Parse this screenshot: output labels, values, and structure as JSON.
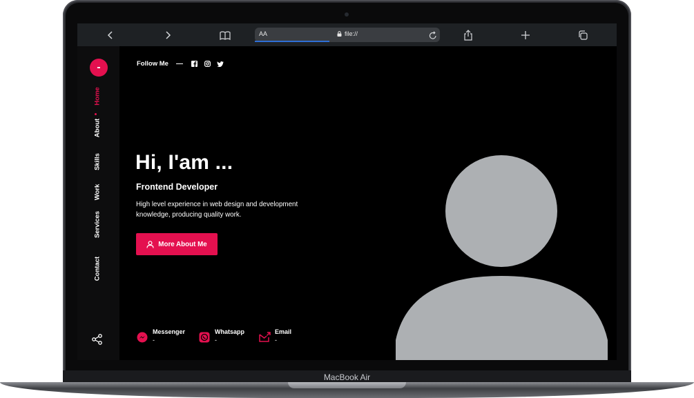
{
  "device": {
    "brand_label": "MacBook Air"
  },
  "browser": {
    "text_size_button": "AA",
    "url": "file://",
    "icons": [
      "back-icon",
      "forward-icon",
      "bookmarks-icon",
      "lock-icon",
      "reload-icon",
      "share-icon",
      "new-tab-icon",
      "tabs-icon"
    ]
  },
  "site": {
    "logo_text": "-",
    "nav": [
      "Home",
      "About",
      "Skills",
      "Work",
      "Services",
      "Contact"
    ],
    "active_nav": "Home",
    "follow_label": "Follow Me",
    "social_icons": [
      "facebook-icon",
      "instagram-icon",
      "twitter-icon"
    ],
    "hero": {
      "title": "Hi, I'am ...",
      "subtitle": "Frontend Developer",
      "description": "High level experience in web design and development knowledge, producing quality work.",
      "button_label": "More About Me"
    },
    "contacts": [
      {
        "title": "Messenger",
        "value": "-"
      },
      {
        "title": "Whatsapp",
        "value": "-"
      },
      {
        "title": "Email",
        "value": "-"
      }
    ],
    "colors": {
      "accent": "#e4104f",
      "avatar": "#adb0b3",
      "background": "#000000",
      "sidebar": "#0d0d0e"
    }
  }
}
